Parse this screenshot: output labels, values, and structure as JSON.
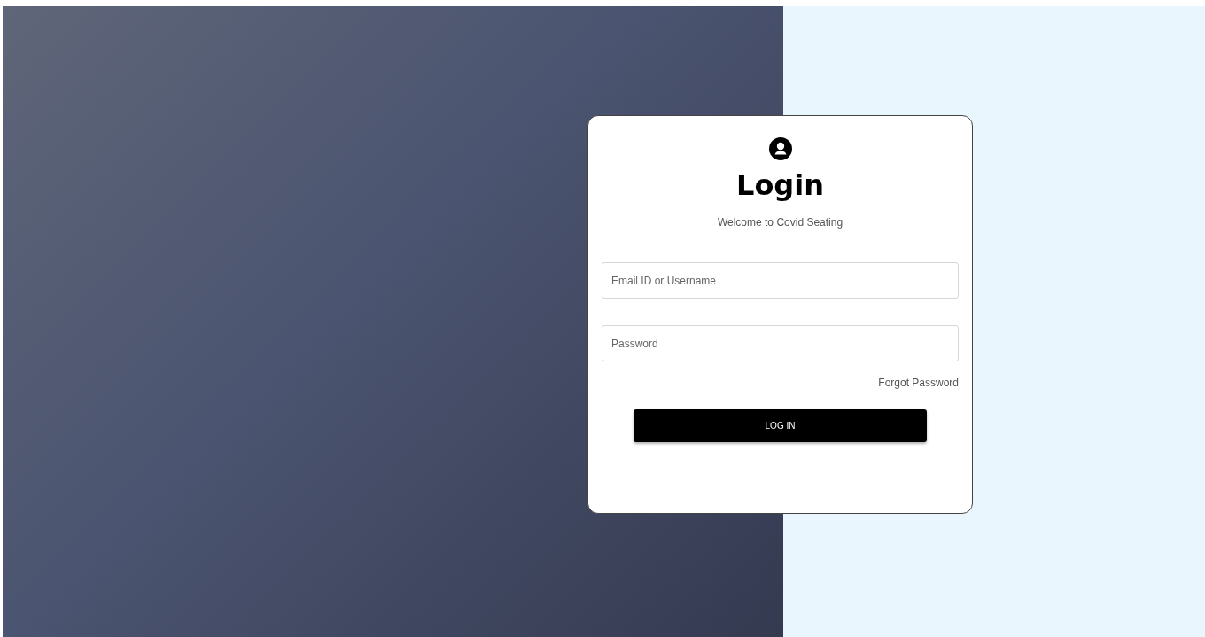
{
  "login": {
    "title": "Login",
    "subtitle": "Welcome to Covid Seating",
    "fields": [
      {
        "placeholder": "Email ID or Username"
      },
      {
        "placeholder": "Password"
      }
    ],
    "forgot_link": "Forgot Password",
    "button": "LOG IN"
  }
}
